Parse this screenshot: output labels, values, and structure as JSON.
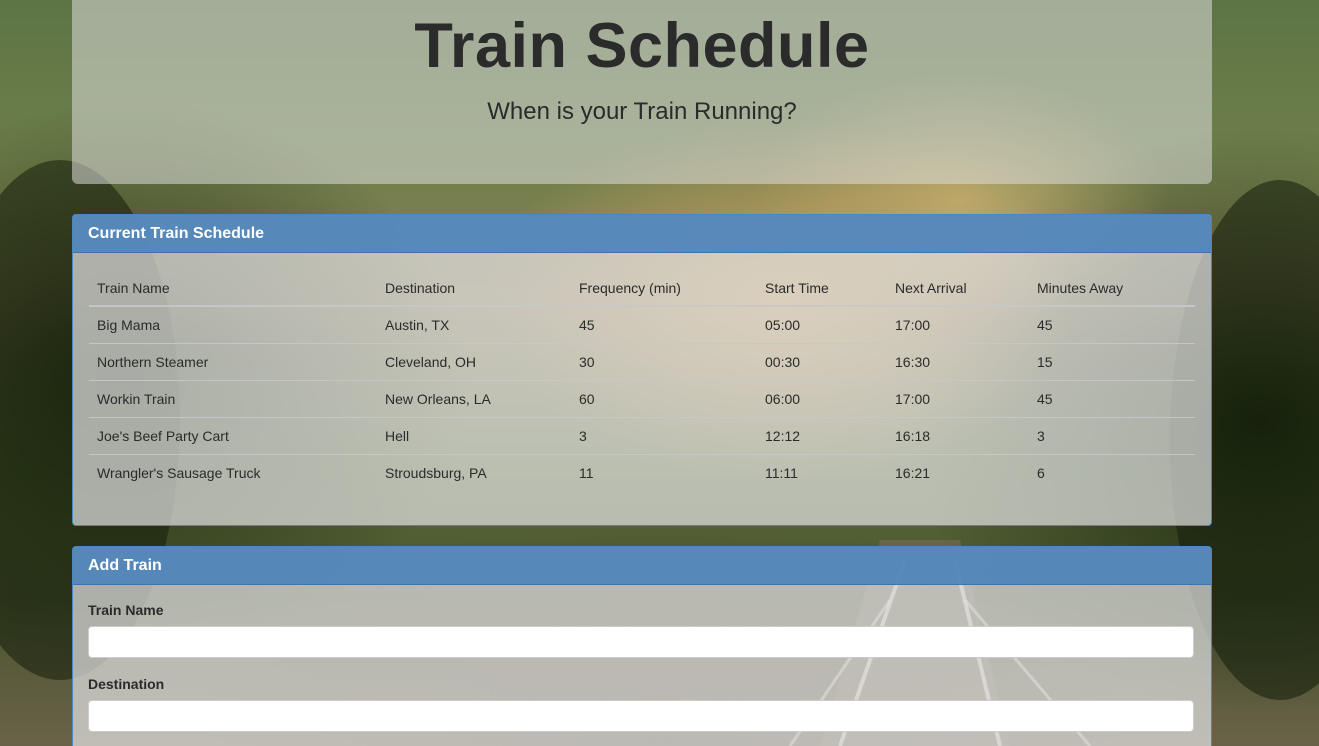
{
  "header": {
    "title": "Train Schedule",
    "subtitle": "When is your Train Running?"
  },
  "schedule_panel": {
    "heading": "Current Train Schedule",
    "columns": [
      "Train Name",
      "Destination",
      "Frequency (min)",
      "Start Time",
      "Next Arrival",
      "Minutes Away"
    ],
    "rows": [
      [
        "Big Mama",
        "Austin, TX",
        "45",
        "05:00",
        "17:00",
        "45"
      ],
      [
        "Northern Steamer",
        "Cleveland, OH",
        "30",
        "00:30",
        "16:30",
        "15"
      ],
      [
        "Workin Train",
        "New Orleans, LA",
        "60",
        "06:00",
        "17:00",
        "45"
      ],
      [
        "Joe's Beef Party Cart",
        "Hell",
        "3",
        "12:12",
        "16:18",
        "3"
      ],
      [
        "Wrangler's Sausage Truck",
        "Stroudsburg, PA",
        "11",
        "11:11",
        "16:21",
        "6"
      ]
    ]
  },
  "add_panel": {
    "heading": "Add Train",
    "fields": [
      {
        "label": "Train Name",
        "value": ""
      },
      {
        "label": "Destination",
        "value": ""
      }
    ]
  },
  "colors": {
    "panel_heading": "#4d83ba",
    "panel_border": "#4a87c2",
    "text": "#2b2b2b"
  }
}
